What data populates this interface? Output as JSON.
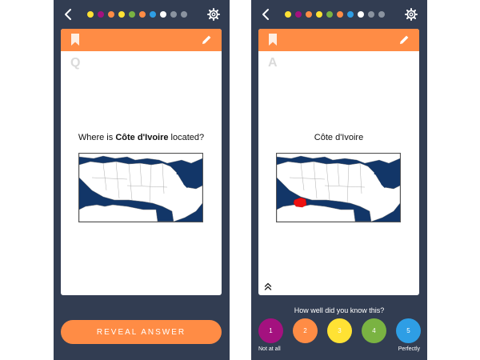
{
  "question_screen": {
    "progress_dots": [
      "#ffe234",
      "#a4117f",
      "#ff8c45",
      "#ffe234",
      "#7ab342",
      "#ff8c45",
      "#2e9ee5",
      "#ffffff",
      "#8a93a0",
      "#8a93a0"
    ],
    "card": {
      "side_letter": "Q",
      "prompt_prefix": "Where is ",
      "prompt_country": "Côte d'Ivoire",
      "prompt_suffix": " located?"
    },
    "reveal_button_label": "REVEAL ANSWER"
  },
  "answer_screen": {
    "progress_dots": [
      "#ffe234",
      "#a4117f",
      "#ff8c45",
      "#ffe234",
      "#7ab342",
      "#ff8c45",
      "#2e9ee5",
      "#ffffff",
      "#8a93a0",
      "#8a93a0"
    ],
    "card": {
      "side_letter": "A",
      "answer_text": "Côte d'Ivoire"
    },
    "rating": {
      "question": "How well did you know this?",
      "options": [
        {
          "label": "1",
          "color": "#a4117f"
        },
        {
          "label": "2",
          "color": "#ff8c45"
        },
        {
          "label": "3",
          "color": "#ffe234"
        },
        {
          "label": "4",
          "color": "#7ab342"
        },
        {
          "label": "5",
          "color": "#2e9ee5"
        }
      ],
      "low_label": "Not at all",
      "high_label": "Perfectly"
    }
  },
  "colors": {
    "accent": "#ff8c45",
    "background": "#323d52",
    "ocean": "#123668",
    "highlight": "#ee1111"
  }
}
